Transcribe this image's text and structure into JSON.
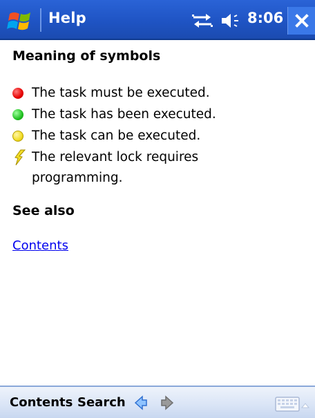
{
  "titlebar": {
    "app_title": "Help",
    "time": "8:06",
    "close_label": "✕",
    "start_icon": "windows-flag-icon",
    "sync_icon": "sync-arrows-icon",
    "volume_icon": "speaker-icon"
  },
  "content": {
    "heading": "Meaning of symbols",
    "symbols": [
      {
        "icon": "red-dot-icon",
        "color": "#e60000",
        "text": "The task must be executed."
      },
      {
        "icon": "green-dot-icon",
        "color": "#20c020",
        "text": "The task has been executed."
      },
      {
        "icon": "yellow-dot-icon",
        "color": "#f2dd27",
        "text": "The task can be executed."
      },
      {
        "icon": "lock-programming-icon",
        "color": "#e6d000",
        "text": "The relevant lock requires programming."
      }
    ],
    "see_also_heading": "See also",
    "link_text": "Contents"
  },
  "bottombar": {
    "menu_contents": "Contents",
    "menu_search": "Search",
    "back_icon": "back-arrow-icon",
    "forward_icon": "forward-arrow-icon",
    "keyboard_icon": "keyboard-icon"
  },
  "colors": {
    "titlebar_blue": "#1f54c4",
    "link_blue": "#0000ee",
    "bottombar": "#d9e4f6"
  }
}
